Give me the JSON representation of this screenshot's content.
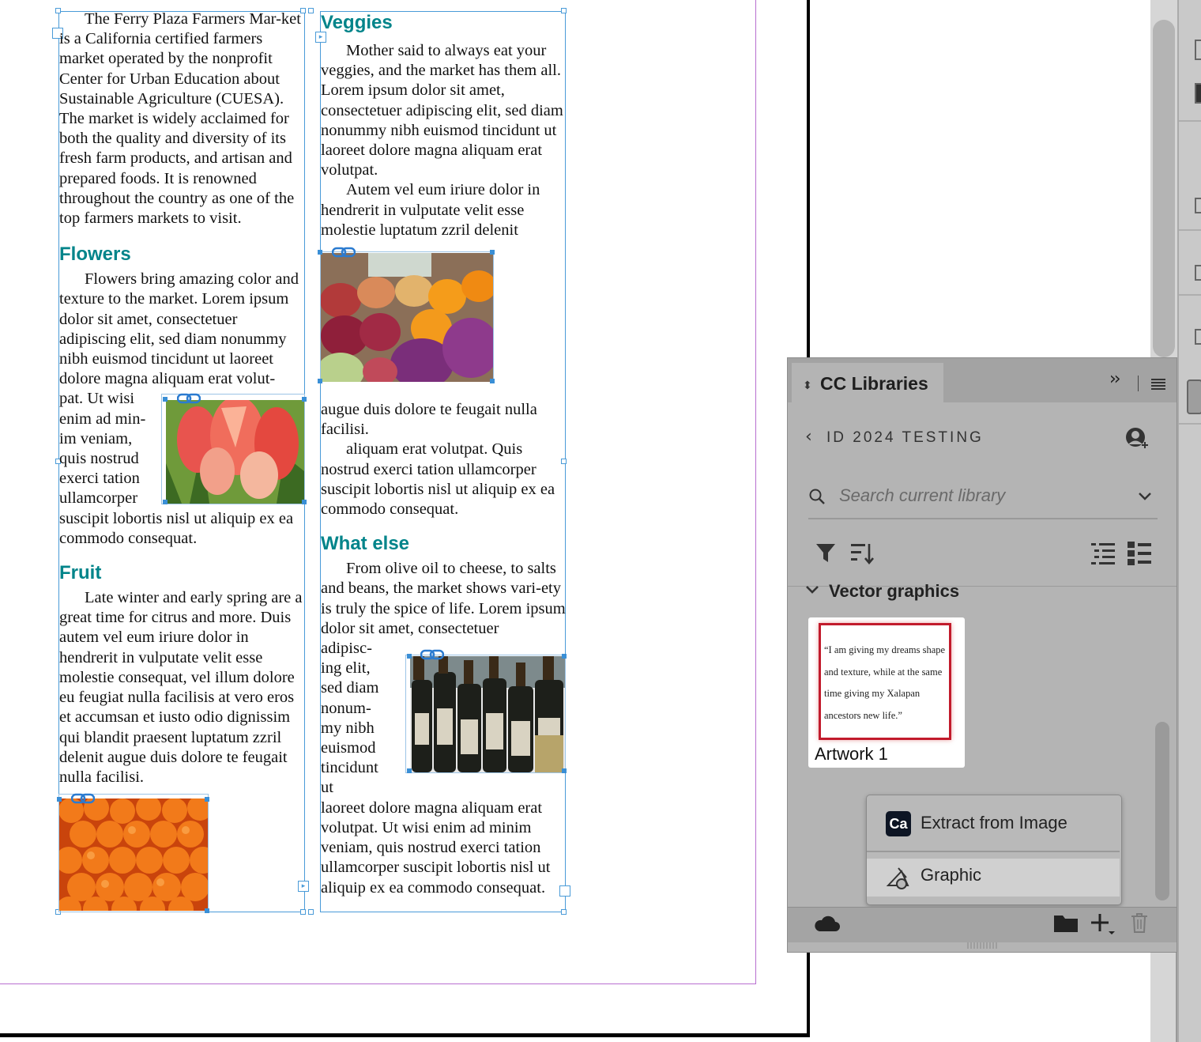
{
  "document": {
    "col1_intro": "The Ferry Plaza Farmers Mar-ket is a California certified farmers market operated by the nonprofit Center for Urban Education about Sustainable Agriculture (CUESA). The market is widely acclaimed for both the quality and diversity of its fresh farm products, and artisan and prepared foods. It is renowned throughout the country as one of the top farmers markets to visit.",
    "flowers_heading": "Flowers",
    "flowers_text_a": "Flowers bring amazing color and texture to the market. Lorem ipsum dolor sit amet, consectetuer adipiscing elit, sed diam nonummy nibh euismod tincidunt ut laoreet dolore magna aliquam erat volut-",
    "flowers_text_b": "pat. Ut wisi enim ad min-im veniam, quis nostrud exerci tation ullamcorper",
    "flowers_text_c": "suscipit lobortis nisl ut aliquip ex ea commodo consequat.",
    "fruit_heading": "Fruit",
    "fruit_text": "Late winter and early spring are a great time for citrus and more. Duis autem vel eum iriure dolor in hendrerit in vulputate velit esse molestie consequat, vel illum dolore eu feugiat nulla facilisis at vero eros et accumsan et iusto odio dignissim qui blandit praesent luptatum zzril delenit augue duis dolore te feugait nulla facilisi.",
    "veggies_heading": "Veggies",
    "veggies_text_a": "Mother said to always eat your veggies, and the market has them all. Lorem ipsum dolor sit amet, consectetuer adipiscing elit, sed diam nonummy nibh euismod tincidunt ut laoreet dolore magna aliquam erat volutpat.",
    "veggies_text_b": "Autem vel eum iriure dolor in hendrerit in vulputate velit esse molestie luptatum zzril delenit",
    "veggies_text_c": "augue duis dolore te feugait nulla facilisi.",
    "veggies_text_d": "aliquam erat volutpat. Quis nostrud exerci tation ullamcorper suscipit lobortis nisl ut aliquip ex ea commodo consequat.",
    "whatelse_heading": "What else",
    "whatelse_text_a": "From olive oil to cheese, to salts and beans, the market shows vari-ety is truly the spice of life. Lorem ipsum dolor sit amet, consectetuer",
    "whatelse_text_b": "adipisc-ing elit, sed diam nonum-my nibh euismod tincidunt ut",
    "whatelse_text_c": "laoreet dolore magna aliquam erat volutpat. Ut wisi enim ad minim veniam, quis nostrud exerci tation ullamcorper suscipit lobortis nisl ut aliquip ex ea commodo consequat."
  },
  "panel": {
    "title": "CC Libraries",
    "library_name": "ID 2024 TESTING",
    "search_placeholder": "Search current library",
    "section_label": "Vector graphics",
    "asset": {
      "name": "Artwork 1",
      "quote": "“I am giving my dreams shape and texture, while at the same time giving my Xalapan ancestors new life.”"
    },
    "menu": {
      "extract_label": "Extract from Image",
      "extract_badge": "Ca",
      "graphic_label": "Graphic"
    }
  },
  "colors": {
    "heading_teal": "#00848a",
    "frame_blue": "#4a9bd8",
    "margin_purple": "#b86fd0",
    "panel_gray": "#b4b4b4"
  },
  "icons": [
    "link-icon",
    "chevron-updown-icon",
    "collapse-icon",
    "panel-menu-icon",
    "back-chevron-icon",
    "add-user-icon",
    "search-icon",
    "dropdown-chevron-icon",
    "filter-icon",
    "sort-icon",
    "list-view-icon",
    "grid-list-view-icon",
    "cloud-icon",
    "folder-icon",
    "add-icon",
    "trash-icon",
    "graphic-icon"
  ]
}
